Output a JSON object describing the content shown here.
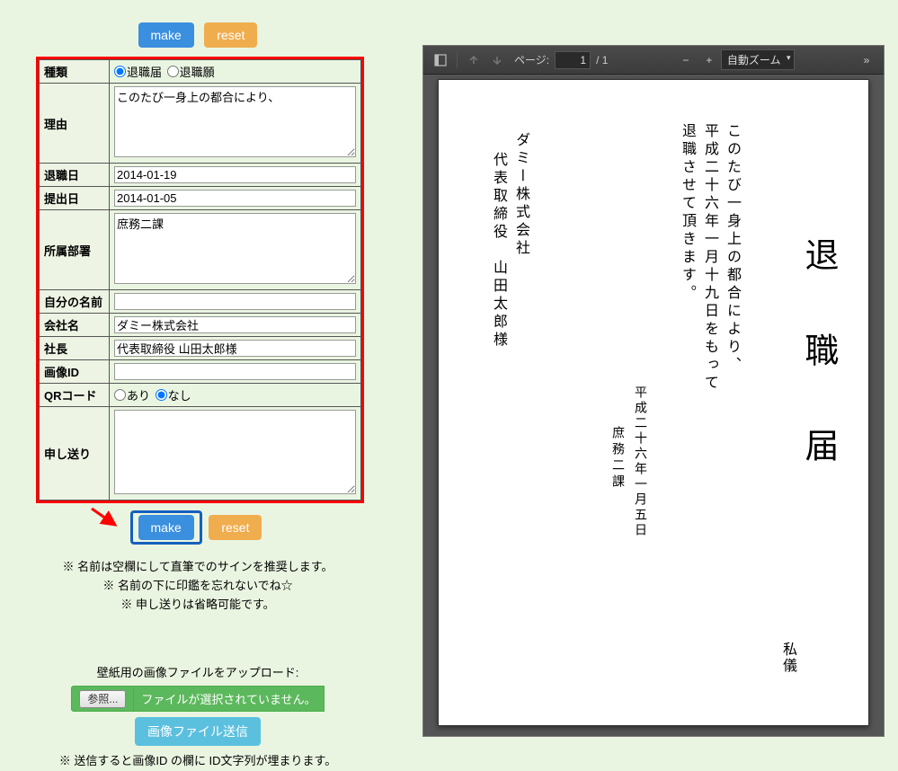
{
  "buttons": {
    "make": "make",
    "reset": "reset"
  },
  "form": {
    "labels": {
      "type": "種類",
      "reason": "理由",
      "resign_date": "退職日",
      "submit_date": "提出日",
      "department": "所属部署",
      "my_name": "自分の名前",
      "company": "会社名",
      "president": "社長",
      "image_id": "画像ID",
      "qr": "QRコード",
      "memo": "申し送り"
    },
    "type_options": {
      "notice": "退職届",
      "request": "退職願"
    },
    "type_selected": "notice",
    "reason": "このたび一身上の都合により、",
    "resign_date": "2014-01-19",
    "submit_date": "2014-01-05",
    "department": "庶務二課",
    "my_name": "",
    "company": "ダミー株式会社",
    "president": "代表取締役 山田太郎様",
    "image_id": "",
    "qr_options": {
      "yes": "あり",
      "no": "なし"
    },
    "qr_selected": "no",
    "memo": ""
  },
  "notes": {
    "line1": "※ 名前は空欄にして直筆でのサインを推奨します。",
    "line2": "※ 名前の下に印鑑を忘れないでね☆",
    "line3": "※ 申し送りは省略可能です。"
  },
  "upload": {
    "heading": "壁紙用の画像ファイルをアップロード:",
    "browse": "参照...",
    "no_file": "ファイルが選択されていません。",
    "send": "画像ファイル送信",
    "hint": "※ 送信すると画像ID の欄に ID文字列が埋まります。"
  },
  "pdf": {
    "page_label": "ページ:",
    "page_current": "1",
    "page_total": "/ 1",
    "zoom": "自動ズーム",
    "minus": "−",
    "plus": "+",
    "expand": "»"
  },
  "document": {
    "title": "退職届",
    "shigi": "私儀",
    "body1": "このたび一身上の都合により、",
    "body2": "平成二十六年一月十九日をもって",
    "body3": "退職させて頂きます。",
    "submit_date_jp": "平成二十六年一月五日",
    "department": "庶務二課",
    "company": "ダミー株式会社",
    "president": "代表取締役　山田太郎様"
  }
}
